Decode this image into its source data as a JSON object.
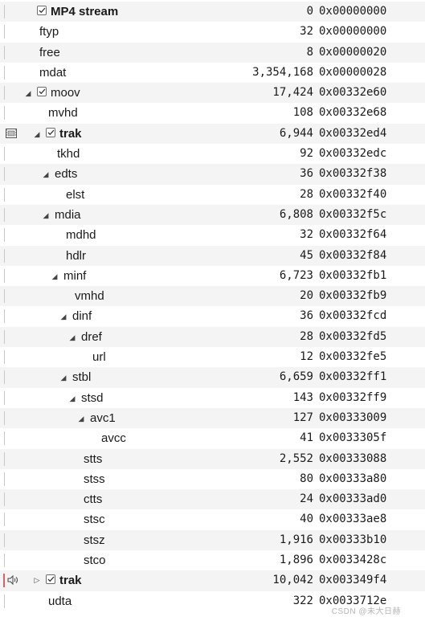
{
  "watermark": "CSDN @未大日赫",
  "rows": [
    {
      "name": "MP4 stream",
      "bold": true,
      "checkbox": true,
      "toggle": "none",
      "indent": 0,
      "lead": "line",
      "size": "0",
      "offset": "0x00000000"
    },
    {
      "name": "ftyp",
      "bold": false,
      "checkbox": false,
      "toggle": "none",
      "indent": 1,
      "lead": "line",
      "size": "32",
      "offset": "0x00000000"
    },
    {
      "name": "free",
      "bold": false,
      "checkbox": false,
      "toggle": "none",
      "indent": 1,
      "lead": "line",
      "size": "8",
      "offset": "0x00000020"
    },
    {
      "name": "mdat",
      "bold": false,
      "checkbox": false,
      "toggle": "none",
      "indent": 1,
      "lead": "line",
      "size": "3,354,168",
      "offset": "0x00000028"
    },
    {
      "name": "moov",
      "bold": false,
      "checkbox": true,
      "toggle": "open",
      "indent": 0,
      "lead": "line",
      "size": "17,424",
      "offset": "0x00332e60"
    },
    {
      "name": "mvhd",
      "bold": false,
      "checkbox": false,
      "toggle": "none",
      "indent": 2,
      "lead": "line",
      "size": "108",
      "offset": "0x00332e68"
    },
    {
      "name": "trak",
      "bold": true,
      "checkbox": true,
      "toggle": "open",
      "indent": 1,
      "lead": "film",
      "size": "6,944",
      "offset": "0x00332ed4"
    },
    {
      "name": "tkhd",
      "bold": false,
      "checkbox": false,
      "toggle": "none",
      "indent": 3,
      "lead": "line",
      "size": "92",
      "offset": "0x00332edc"
    },
    {
      "name": "edts",
      "bold": false,
      "checkbox": false,
      "toggle": "open",
      "indent": 2,
      "lead": "line",
      "size": "36",
      "offset": "0x00332f38"
    },
    {
      "name": "elst",
      "bold": false,
      "checkbox": false,
      "toggle": "none",
      "indent": 4,
      "lead": "line",
      "size": "28",
      "offset": "0x00332f40"
    },
    {
      "name": "mdia",
      "bold": false,
      "checkbox": false,
      "toggle": "open",
      "indent": 2,
      "lead": "line",
      "size": "6,808",
      "offset": "0x00332f5c"
    },
    {
      "name": "mdhd",
      "bold": false,
      "checkbox": false,
      "toggle": "none",
      "indent": 4,
      "lead": "line",
      "size": "32",
      "offset": "0x00332f64"
    },
    {
      "name": "hdlr",
      "bold": false,
      "checkbox": false,
      "toggle": "none",
      "indent": 4,
      "lead": "line",
      "size": "45",
      "offset": "0x00332f84"
    },
    {
      "name": "minf",
      "bold": false,
      "checkbox": false,
      "toggle": "open",
      "indent": 3,
      "lead": "line",
      "size": "6,723",
      "offset": "0x00332fb1"
    },
    {
      "name": "vmhd",
      "bold": false,
      "checkbox": false,
      "toggle": "none",
      "indent": 5,
      "lead": "line",
      "size": "20",
      "offset": "0x00332fb9"
    },
    {
      "name": "dinf",
      "bold": false,
      "checkbox": false,
      "toggle": "open",
      "indent": 4,
      "lead": "line",
      "size": "36",
      "offset": "0x00332fcd"
    },
    {
      "name": "dref",
      "bold": false,
      "checkbox": false,
      "toggle": "open",
      "indent": 5,
      "lead": "line",
      "size": "28",
      "offset": "0x00332fd5"
    },
    {
      "name": "url",
      "bold": false,
      "checkbox": false,
      "toggle": "none",
      "indent": 7,
      "lead": "line",
      "size": "12",
      "offset": "0x00332fe5"
    },
    {
      "name": "stbl",
      "bold": false,
      "checkbox": false,
      "toggle": "open",
      "indent": 4,
      "lead": "line",
      "size": "6,659",
      "offset": "0x00332ff1"
    },
    {
      "name": "stsd",
      "bold": false,
      "checkbox": false,
      "toggle": "open",
      "indent": 5,
      "lead": "line",
      "size": "143",
      "offset": "0x00332ff9"
    },
    {
      "name": "avc1",
      "bold": false,
      "checkbox": false,
      "toggle": "open",
      "indent": 6,
      "lead": "line",
      "size": "127",
      "offset": "0x00333009"
    },
    {
      "name": "avcc",
      "bold": false,
      "checkbox": false,
      "toggle": "none",
      "indent": 8,
      "lead": "line",
      "size": "41",
      "offset": "0x0033305f"
    },
    {
      "name": "stts",
      "bold": false,
      "checkbox": false,
      "toggle": "none",
      "indent": 6,
      "lead": "line",
      "size": "2,552",
      "offset": "0x00333088"
    },
    {
      "name": "stss",
      "bold": false,
      "checkbox": false,
      "toggle": "none",
      "indent": 6,
      "lead": "line",
      "size": "80",
      "offset": "0x00333a80"
    },
    {
      "name": "ctts",
      "bold": false,
      "checkbox": false,
      "toggle": "none",
      "indent": 6,
      "lead": "line",
      "size": "24",
      "offset": "0x00333ad0"
    },
    {
      "name": "stsc",
      "bold": false,
      "checkbox": false,
      "toggle": "none",
      "indent": 6,
      "lead": "line",
      "size": "40",
      "offset": "0x00333ae8"
    },
    {
      "name": "stsz",
      "bold": false,
      "checkbox": false,
      "toggle": "none",
      "indent": 6,
      "lead": "line",
      "size": "1,916",
      "offset": "0x00333b10"
    },
    {
      "name": "stco",
      "bold": false,
      "checkbox": false,
      "toggle": "none",
      "indent": 6,
      "lead": "line",
      "size": "1,896",
      "offset": "0x0033428c"
    },
    {
      "name": "trak",
      "bold": true,
      "checkbox": true,
      "toggle": "closed",
      "indent": 1,
      "lead": "audio",
      "size": "10,042",
      "offset": "0x003349f4"
    },
    {
      "name": "udta",
      "bold": false,
      "checkbox": false,
      "toggle": "none",
      "indent": 2,
      "lead": "line",
      "size": "322",
      "offset": "0x0033712e"
    }
  ]
}
